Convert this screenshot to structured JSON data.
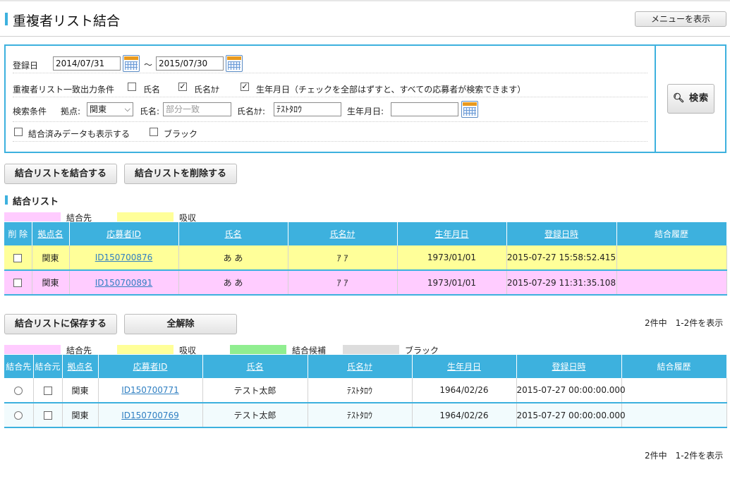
{
  "header": {
    "title": "重複者リスト結合",
    "menu_button": "メニューを表示"
  },
  "search": {
    "reg_date_label": "登録日",
    "date_from": "2014/07/31",
    "tilde": "～",
    "date_to": "2015/07/30",
    "match_label": "重複者リスト一致出力条件",
    "match_name_label": "氏名",
    "match_name_checked": false,
    "match_kana_label": "氏名ｶﾅ",
    "match_kana_checked": true,
    "match_birth_label": "生年月日（チェックを全部はずすと、すべての応募者が検索できます）",
    "match_birth_checked": true,
    "cond_label": "検索条件",
    "base_label": "拠点:",
    "base_value": "関東",
    "name_label": "氏名:",
    "name_placeholder": "部分一致",
    "kana_label": "氏名ｶﾅ:",
    "kana_value": "ﾃｽﾄﾀﾛｳ",
    "birth_label": "生年月日:",
    "birth_value": "",
    "show_merged_label": "結合済みデータも表示する",
    "black_label": "ブラック",
    "search_button": "検索"
  },
  "actions": {
    "merge_button": "結合リストを結合する",
    "delete_button": "結合リストを削除する",
    "save_button": "結合リストに保存する",
    "clear_button": "全解除"
  },
  "merge_section": {
    "title": "結合リスト",
    "legend": [
      {
        "label": "結合先",
        "color": "#ffccff"
      },
      {
        "label": "吸収",
        "color": "#ffff99"
      }
    ],
    "columns": [
      "削 除",
      "拠点名",
      "応募者ID",
      "氏名",
      "氏名ｶﾅ",
      "生年月日",
      "登録日時",
      "結合履歴"
    ],
    "rows": [
      {
        "base": "関東",
        "id": "ID150700876",
        "name": "あ あ",
        "kana": "ｱ ｱ",
        "birth": "1973/01/01",
        "registered": "2015-07-27 15:58:52.415",
        "history": "",
        "color": "#ffff99"
      },
      {
        "base": "関東",
        "id": "ID150700891",
        "name": "あ あ",
        "kana": "ｱ ｱ",
        "birth": "1973/01/01",
        "registered": "2015-07-29 11:31:35.108",
        "history": "",
        "color": "#ffccff"
      }
    ]
  },
  "result_section": {
    "count_text": "2件中　1-2件を表示",
    "legend": [
      {
        "label": "結合先",
        "color": "#ffccff"
      },
      {
        "label": "吸収",
        "color": "#ffff99"
      },
      {
        "label": "結合候補",
        "color": "#90ee90"
      },
      {
        "label": "ブラック",
        "color": "#dddddd"
      }
    ],
    "columns": [
      "結合先",
      "結合元",
      "拠点名",
      "応募者ID",
      "氏名",
      "氏名ｶﾅ",
      "生年月日",
      "登録日時",
      "結合履歴"
    ],
    "rows": [
      {
        "base": "関東",
        "id": "ID150700771",
        "name": "テスト太郎",
        "kana": "ﾃｽﾄﾀﾛｳ",
        "birth": "1964/02/26",
        "registered": "2015-07-27 00:00:00.000",
        "history": "",
        "color": "#ffffff"
      },
      {
        "base": "関東",
        "id": "ID150700769",
        "name": "テスト太郎",
        "kana": "ﾃｽﾄﾀﾛｳ",
        "birth": "1964/02/26",
        "registered": "2015-07-27 00:00:00.000",
        "history": "",
        "color": "#f2fbfd"
      }
    ],
    "footer_count_text": "2件中　1-2件を表示"
  }
}
